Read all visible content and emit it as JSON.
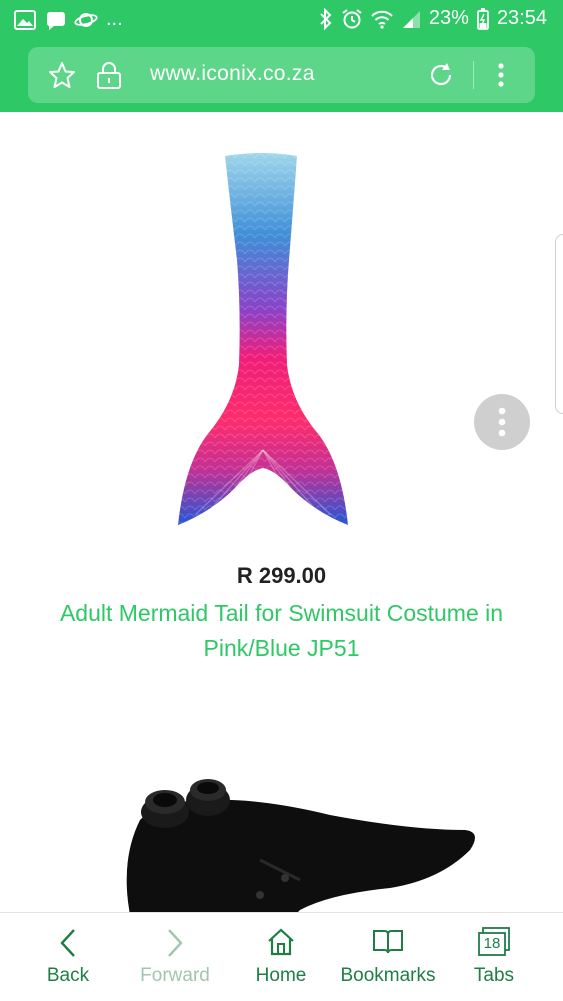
{
  "status_bar": {
    "notif_more": "...",
    "battery_percent": "23%",
    "time": "23:54"
  },
  "browser": {
    "url": "www.iconix.co.za"
  },
  "product": {
    "price": "R 299.00",
    "title": "Adult Mermaid Tail for Swimsuit Costume in Pink/Blue JP51"
  },
  "bottom_nav": {
    "back": "Back",
    "forward": "Forward",
    "home": "Home",
    "bookmarks": "Bookmarks",
    "tabs": "Tabs",
    "tabs_count": "18"
  },
  "colors": {
    "brand_green": "#2ec866",
    "url_bar": "#5dd68a"
  }
}
